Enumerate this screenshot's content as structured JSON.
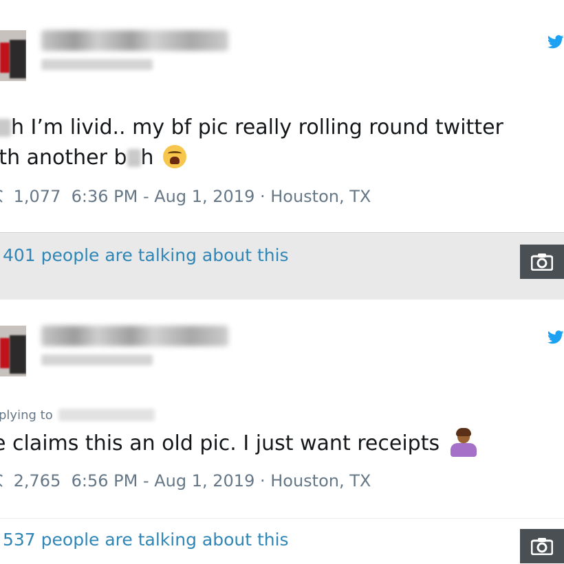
{
  "tweets": [
    {
      "text_part1": "h I’m livid.. my bf pic really rolling round twitter",
      "text_line2_start": "ith another b",
      "text_line2_end": "h",
      "emoji": "weary-face",
      "likes": "1,077",
      "datetime": "6:36 PM - Aug 1, 2019",
      "location": "Houston, TX",
      "talking": "401 people are talking about this"
    },
    {
      "replying_to": "plying to",
      "text": "e claims this an old pic. I just want receipts",
      "emoji": "person-shrugging",
      "likes": "2,765",
      "datetime": "6:56 PM - Aug 1, 2019",
      "location": "Houston, TX",
      "talking": "537 people are talking about this"
    }
  ],
  "icons": {
    "brand": "twitter-bird-icon",
    "like": "heart-icon",
    "camera": "camera-icon"
  },
  "colors": {
    "twitter_blue": "#1da1f2",
    "link": "#2f86b6",
    "meta_gray": "#657786",
    "camera_bg": "#4a4f54"
  }
}
